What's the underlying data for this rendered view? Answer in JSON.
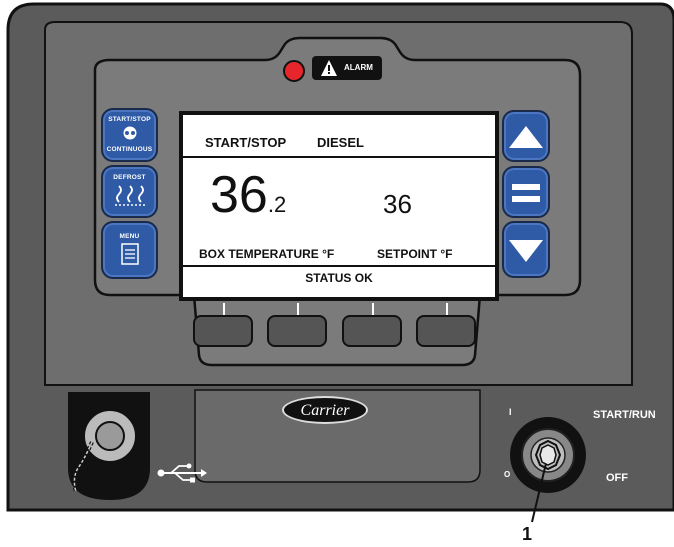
{
  "alarm": {
    "label": "ALARM",
    "led_color": "#e6262b"
  },
  "left_buttons": [
    {
      "top_label": "START/STOP",
      "bottom_label": "CONTINUOUS",
      "icon": "start-stop-icon"
    },
    {
      "top_label": "DEFROST",
      "bottom_label": "",
      "icon": "defrost-icon"
    },
    {
      "top_label": "MENU",
      "bottom_label": "",
      "icon": "menu-icon"
    }
  ],
  "right_buttons": [
    {
      "icon": "up-arrow-icon"
    },
    {
      "icon": "equals-icon"
    },
    {
      "icon": "down-arrow-icon"
    }
  ],
  "display": {
    "mode_label": "START/STOP",
    "fuel_label": "DIESEL",
    "box_temp_whole": "36",
    "box_temp_decimal": ".2",
    "setpoint_value": "36",
    "box_temp_label": "BOX TEMPERATURE °F",
    "setpoint_label": "SETPOINT °F",
    "status": "STATUS OK"
  },
  "brand": "Carrier",
  "switch": {
    "on_mark": "I",
    "off_mark": "O",
    "on_label": "START/RUN",
    "off_label": "OFF"
  },
  "callout": "1",
  "colors": {
    "button_blue": "#2f5aa6",
    "panel_gray": "#5a5a5a",
    "bezel_gray": "#7a7a7a"
  },
  "icons": {
    "usb": "usb-icon",
    "cap": "usb-cap-icon",
    "key": "key-switch-icon"
  }
}
